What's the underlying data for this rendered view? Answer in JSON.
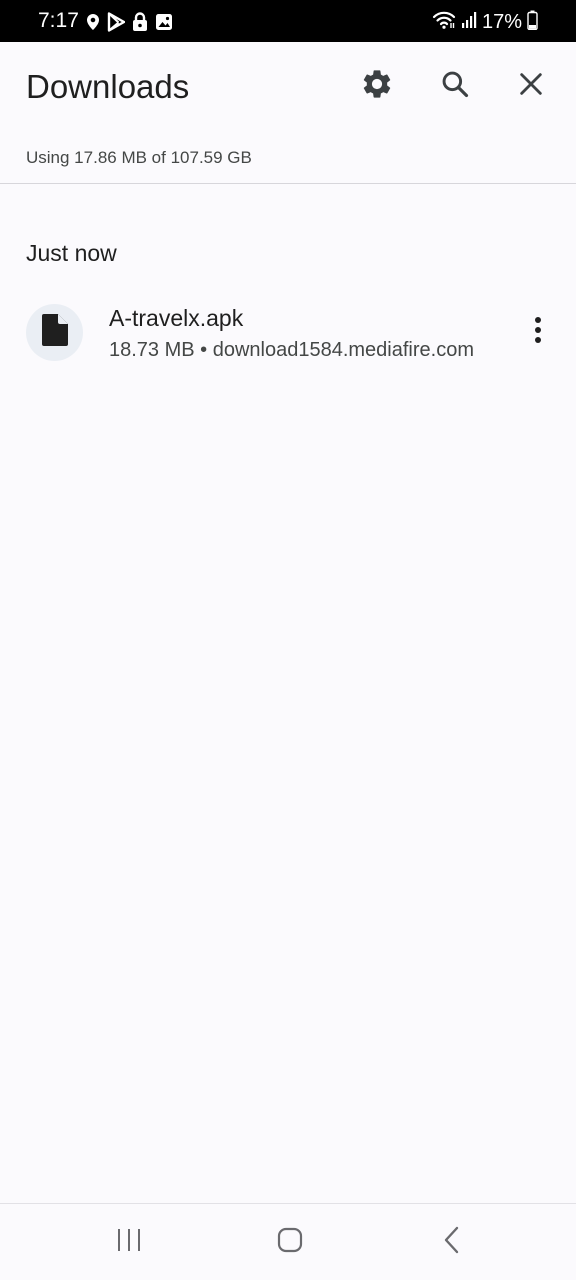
{
  "status_bar": {
    "time": "7:17",
    "battery": "17%",
    "icons_left": [
      "location-icon",
      "play-store-icon",
      "lock-icon",
      "image-icon"
    ],
    "icons_right": [
      "wifi-icon",
      "signal-icon",
      "battery-icon"
    ]
  },
  "header": {
    "title": "Downloads",
    "actions": [
      "settings-icon",
      "search-icon",
      "close-icon"
    ]
  },
  "storage": {
    "text": "Using 17.86 MB of 107.59 GB"
  },
  "sections": [
    {
      "heading": "Just now",
      "items": [
        {
          "name": "A-travelx.apk",
          "meta": "18.73 MB • download1584.mediafire.com",
          "icon": "file-icon"
        }
      ]
    }
  ],
  "nav_bar": {
    "buttons": [
      "recents-icon",
      "home-icon",
      "back-icon"
    ]
  },
  "colors": {
    "background": "#fbfafd",
    "text_primary": "#1f1f1f",
    "text_secondary": "#444746",
    "icon": "#3c4043",
    "thumb_bg": "#eaeef4"
  }
}
